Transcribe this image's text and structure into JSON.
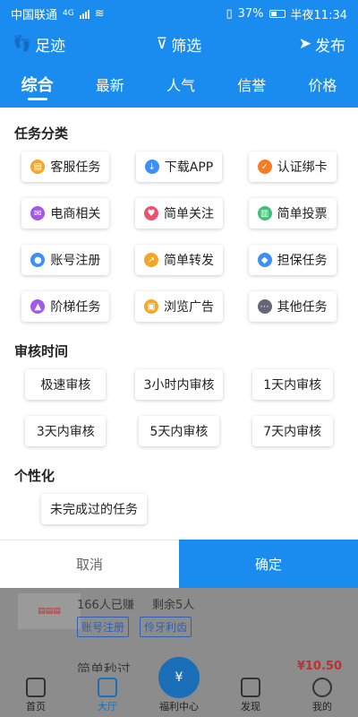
{
  "status": {
    "carrier": "中国联通",
    "signal_label": "4G",
    "battery": "37%",
    "time": "半夜11:34"
  },
  "header": {
    "left_label": "足迹",
    "center_label": "筛选",
    "right_label": "发布"
  },
  "tabs": [
    {
      "label": "综合",
      "active": true
    },
    {
      "label": "最新",
      "active": false
    },
    {
      "label": "人气",
      "active": false
    },
    {
      "label": "信誉",
      "active": false
    },
    {
      "label": "价格",
      "active": false
    }
  ],
  "sections": {
    "category_title": "任务分类",
    "categories": [
      {
        "label": "客服任务",
        "icon": "doc-icon",
        "color": "#f5a623"
      },
      {
        "label": "下载APP",
        "icon": "download-icon",
        "color": "#3d8ef7"
      },
      {
        "label": "认证绑卡",
        "icon": "check-icon",
        "color": "#f57c23"
      },
      {
        "label": "电商相关",
        "icon": "mail-icon",
        "color": "#a259e6"
      },
      {
        "label": "简单关注",
        "icon": "heart-icon",
        "color": "#f0506e"
      },
      {
        "label": "简单投票",
        "icon": "chart-icon",
        "color": "#3fbf78"
      },
      {
        "label": "账号注册",
        "icon": "user-icon",
        "color": "#3d8ef7"
      },
      {
        "label": "简单转发",
        "icon": "share-icon",
        "color": "#f5a623"
      },
      {
        "label": "担保任务",
        "icon": "shield-icon",
        "color": "#3d8ef7"
      },
      {
        "label": "阶梯任务",
        "icon": "ladder-icon",
        "color": "#a259e6"
      },
      {
        "label": "浏览广告",
        "icon": "ad-icon",
        "color": "#f5a623"
      },
      {
        "label": "其他任务",
        "icon": "more-icon",
        "color": "#666677"
      }
    ],
    "time_title": "审核时间",
    "times": [
      "极速审核",
      "3小时内审核",
      "1天内审核",
      "3天内审核",
      "5天内审核",
      "7天内审核"
    ],
    "personal_title": "个性化",
    "personal": [
      "未完成过的任务"
    ]
  },
  "actions": {
    "cancel": "取消",
    "confirm": "确定"
  },
  "background_list": {
    "earned": "166人已赚",
    "remaining": "剩余5人",
    "tag1": "账号注册",
    "tag2": "伶牙利齿",
    "title_partial": "简单秒过",
    "price_partial": "¥10.50"
  },
  "bottom_nav": [
    {
      "label": "首页",
      "icon": "home-icon",
      "active": false
    },
    {
      "label": "大厅",
      "icon": "hall-icon",
      "active": true
    },
    {
      "label": "福利中心",
      "icon": "money-bag-icon",
      "active": false
    },
    {
      "label": "发现",
      "icon": "gift-icon",
      "active": false
    },
    {
      "label": "我的",
      "icon": "profile-icon",
      "active": false
    }
  ]
}
